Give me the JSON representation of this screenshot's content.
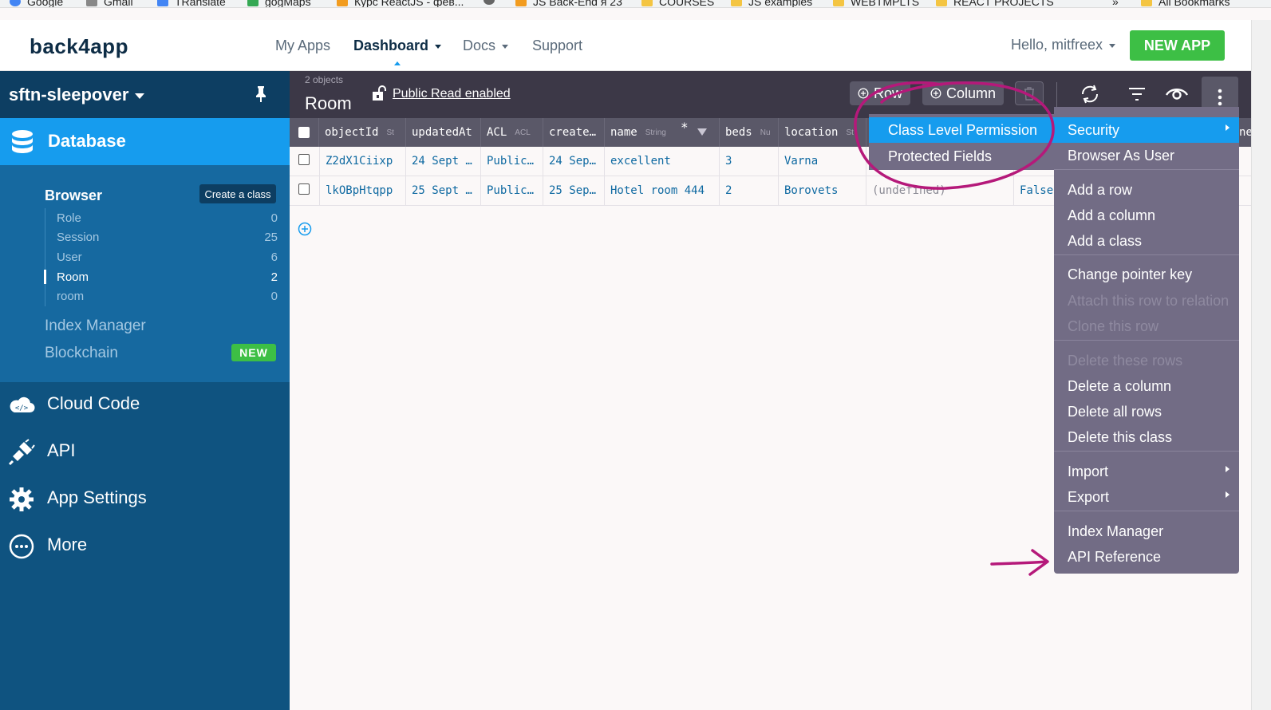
{
  "bookmarks": [
    {
      "label": "Google"
    },
    {
      "label": "Gmail"
    },
    {
      "label": "TRanslate"
    },
    {
      "label": "gogMaps"
    },
    {
      "label": "Курс ReactJS - фев..."
    },
    {
      "label": ""
    },
    {
      "label": "JS Back-End я 23"
    },
    {
      "label": "COURSES"
    },
    {
      "label": "JS examples"
    },
    {
      "label": "WEBTMPLTS"
    },
    {
      "label": "REACT PROJECTS"
    },
    {
      "label": "»"
    },
    {
      "label": "All Bookmarks"
    }
  ],
  "topnav": {
    "logo": "back4app",
    "links": [
      "My Apps",
      "Dashboard",
      "Docs",
      "Support"
    ],
    "greeting": "Hello, mitfreex",
    "new_app": "NEW APP"
  },
  "sidebar": {
    "app_name": "sftn-sleepover",
    "database": "Database",
    "browser": "Browser",
    "create_class": "Create a class",
    "classes": [
      {
        "name": "Role",
        "count": "0"
      },
      {
        "name": "Session",
        "count": "25"
      },
      {
        "name": "User",
        "count": "6"
      },
      {
        "name": "Room",
        "count": "2"
      },
      {
        "name": "room",
        "count": "0"
      }
    ],
    "index_manager": "Index Manager",
    "blockchain": "Blockchain",
    "new_badge": "NEW",
    "sections": [
      "Cloud Code",
      "API",
      "App Settings",
      "More"
    ]
  },
  "toolbar": {
    "object_count": "2 objects",
    "class_title": "Room",
    "public_read": "Public Read enabled",
    "row_btn": "Row",
    "column_btn": "Column"
  },
  "table": {
    "columns": [
      {
        "name": "objectId",
        "type": "St"
      },
      {
        "name": "updatedAt",
        "type": ""
      },
      {
        "name": "ACL",
        "type": "ACL"
      },
      {
        "name": "create…",
        "type": ""
      },
      {
        "name": "name",
        "type": "String"
      },
      {
        "name": "beds",
        "type": "Nu"
      },
      {
        "name": "location",
        "type": "St"
      },
      {
        "name": "",
        "type": ""
      },
      {
        "name": "",
        "type": ""
      }
    ],
    "rows": [
      [
        "Z2dX1Ciixp",
        "24 Sept …",
        "Public…",
        "24 Sep…",
        "excellent",
        "3",
        "Varna",
        "",
        ""
      ],
      [
        "lkOBpHtqpp",
        "25 Sept …",
        "Public…",
        "25 Sep…",
        "Hotel room 444",
        "2",
        "Borovets",
        "(undefined)",
        "False"
      ]
    ],
    "clipped_header": "ne"
  },
  "security_submenu": [
    "Class Level Permission",
    "Protected Fields"
  ],
  "actions_menu": [
    {
      "label": "Security",
      "state": "selected",
      "submenu": true
    },
    {
      "label": "Browser As User",
      "state": "enabled"
    },
    {
      "label": "Add a row",
      "state": "enabled"
    },
    {
      "label": "Add a column",
      "state": "enabled"
    },
    {
      "label": "Add a class",
      "state": "enabled"
    },
    {
      "label": "Change pointer key",
      "state": "enabled"
    },
    {
      "label": "Attach this row to relation",
      "state": "disabled"
    },
    {
      "label": "Clone this row",
      "state": "disabled"
    },
    {
      "label": "Delete these rows",
      "state": "disabled"
    },
    {
      "label": "Delete a column",
      "state": "enabled"
    },
    {
      "label": "Delete all rows",
      "state": "enabled"
    },
    {
      "label": "Delete this class",
      "state": "enabled"
    },
    {
      "label": "Import",
      "state": "enabled",
      "submenu": true
    },
    {
      "label": "Export",
      "state": "enabled",
      "submenu": true
    },
    {
      "label": "Index Manager",
      "state": "enabled"
    },
    {
      "label": "API Reference",
      "state": "enabled"
    }
  ],
  "colors": {
    "accent": "#169cee",
    "sidebar": "#0f5380",
    "sidebar_dark": "#0d3e62",
    "toolbar": "#3c3847",
    "menu": "#726c85",
    "new_app_green": "#3dbf45",
    "annotation": "#b5197a"
  }
}
